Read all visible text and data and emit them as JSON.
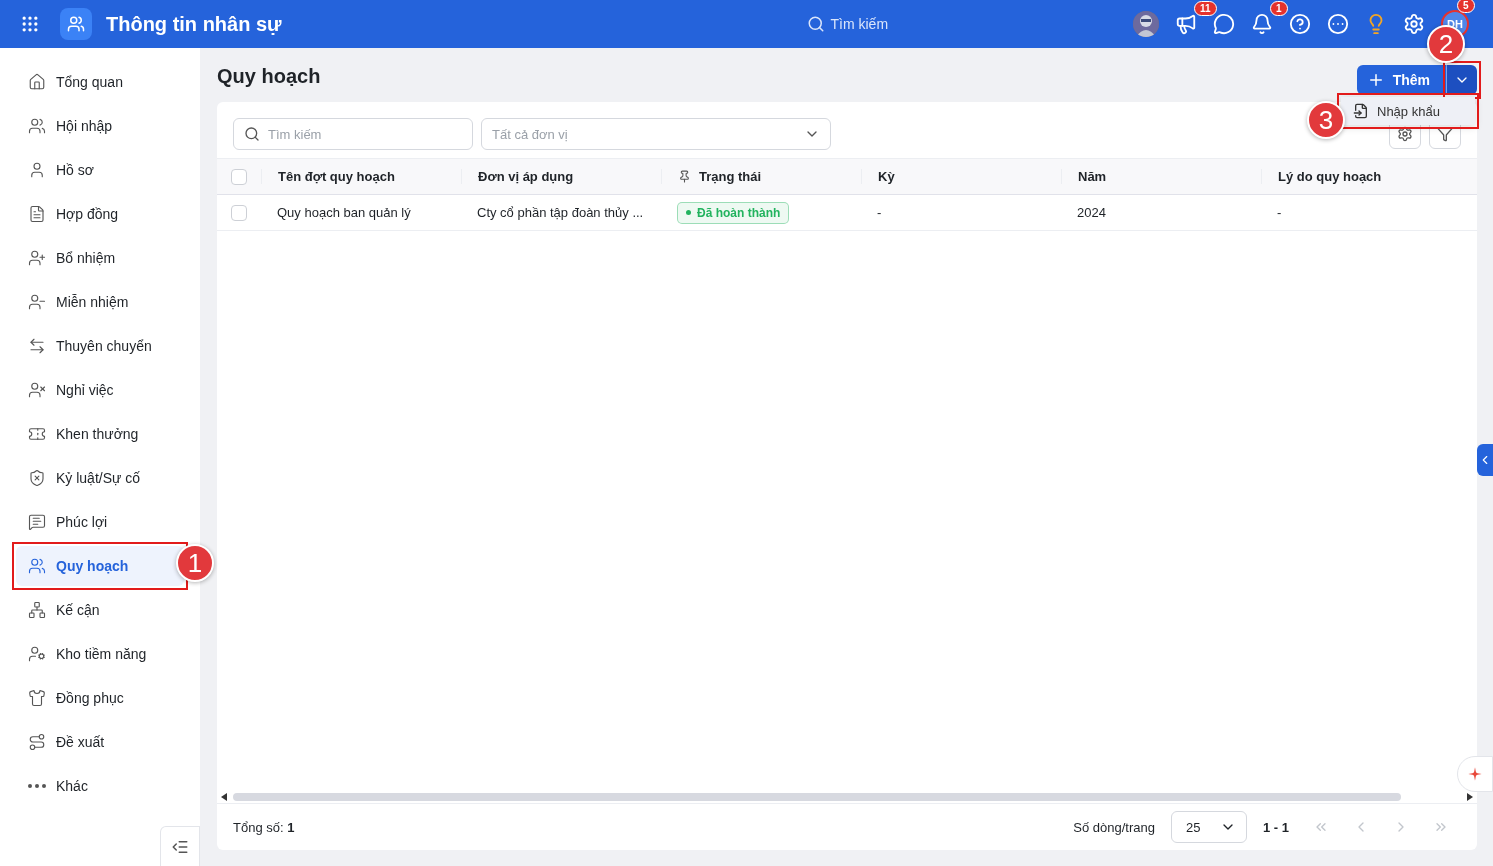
{
  "app": {
    "title": "Thông tin nhân sự",
    "search_placeholder": "Tìm kiếm",
    "notifications": [
      {
        "kind": "megaphone",
        "badge": "11"
      },
      {
        "kind": "chat"
      },
      {
        "kind": "bell",
        "badge": "1"
      },
      {
        "kind": "help"
      },
      {
        "kind": "more"
      },
      {
        "kind": "idea"
      },
      {
        "kind": "settings"
      }
    ],
    "user": {
      "initials": "DH",
      "badge": "5"
    }
  },
  "sidebar": {
    "items": [
      {
        "label": "Tổng quan",
        "selected": false
      },
      {
        "label": "Hội nhập",
        "selected": false
      },
      {
        "label": "Hồ sơ",
        "selected": false
      },
      {
        "label": "Hợp đồng",
        "selected": false
      },
      {
        "label": "Bổ nhiệm",
        "selected": false
      },
      {
        "label": "Miễn nhiệm",
        "selected": false
      },
      {
        "label": "Thuyên chuyển",
        "selected": false
      },
      {
        "label": "Nghỉ việc",
        "selected": false
      },
      {
        "label": "Khen thưởng",
        "selected": false
      },
      {
        "label": "Kỷ luật/Sự cố",
        "selected": false
      },
      {
        "label": "Phúc lợi",
        "selected": false
      },
      {
        "label": "Quy hoạch",
        "selected": true,
        "callout": "1"
      },
      {
        "label": "Kế cận",
        "selected": false
      },
      {
        "label": "Kho tiềm năng",
        "selected": false
      },
      {
        "label": "Đồng phục",
        "selected": false
      },
      {
        "label": "Đề xuất",
        "selected": false
      },
      {
        "label": "Khác",
        "selected": false
      }
    ]
  },
  "page": {
    "title": "Quy hoạch",
    "add_button": "Thêm",
    "dropdown_callout": "2",
    "menu": [
      {
        "label": "Nhập khẩu",
        "callout": "3"
      }
    ]
  },
  "filters": {
    "search_placeholder": "Tìm kiếm",
    "unit_placeholder": "Tất cả đơn vị"
  },
  "table": {
    "all_checked": false,
    "columns": [
      {
        "label": "Tên đợt quy hoạch",
        "pinned": false
      },
      {
        "label": "Đơn vị áp dụng",
        "pinned": false
      },
      {
        "label": "Trạng thái",
        "pinned": true
      },
      {
        "label": "Kỳ",
        "pinned": false
      },
      {
        "label": "Năm",
        "pinned": false
      },
      {
        "label": "Lý do quy hoạch",
        "pinned": false
      }
    ],
    "rows": [
      {
        "checked": false,
        "cells": [
          "Quy hoạch ban quản lý",
          "Cty cổ phần tập đoàn thủy ...",
          {
            "status": "Đã hoàn thành",
            "color": "#22b35e"
          },
          "-",
          "2024",
          "-"
        ]
      }
    ]
  },
  "footer": {
    "total_label": "Tổng số:",
    "total": "1",
    "rows_per_page_label": "Số dòng/trang",
    "rows_per_page": "25",
    "range": "1 - 1"
  }
}
